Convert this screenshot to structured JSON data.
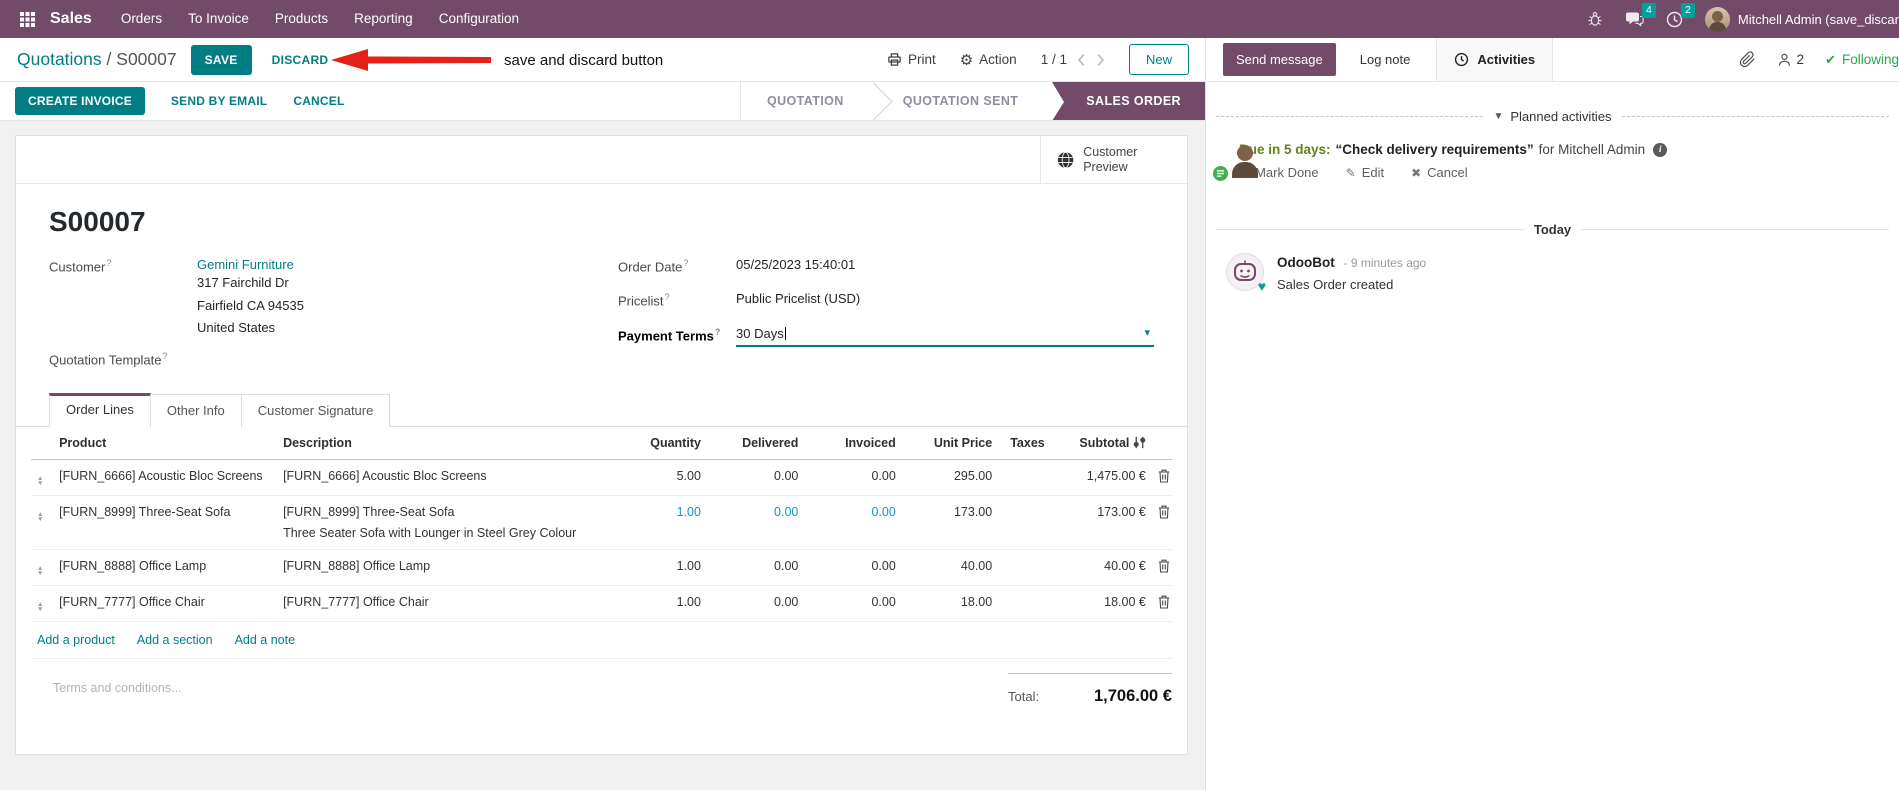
{
  "nav": {
    "app_name": "Sales",
    "menus": [
      "Orders",
      "To Invoice",
      "Products",
      "Reporting",
      "Configuration"
    ],
    "messages_badge": "4",
    "activities_badge": "2",
    "user_name": "Mitchell Admin (save_discar"
  },
  "control_bar": {
    "breadcrumb_parent": "Quotations",
    "breadcrumb_sep": "/",
    "breadcrumb_current": "S00007",
    "save_label": "SAVE",
    "discard_label": "DISCARD",
    "annotation_text": "save and discard button",
    "print_label": "Print",
    "action_label": "Action",
    "pager_value": "1 / 1",
    "new_label": "New"
  },
  "status_bar": {
    "create_invoice": "CREATE INVOICE",
    "send_by_email": "SEND BY EMAIL",
    "cancel": "CANCEL",
    "states": [
      "QUOTATION",
      "QUOTATION SENT",
      "SALES ORDER"
    ],
    "active_state": "SALES ORDER"
  },
  "sheet": {
    "customer_preview": "Customer Preview",
    "title": "S00007",
    "fields": {
      "customer_label": "Customer",
      "customer_name": "Gemini Furniture",
      "customer_address": [
        "317 Fairchild Dr",
        "Fairfield CA 94535",
        "United States"
      ],
      "quotation_template_label": "Quotation Template",
      "order_date_label": "Order Date",
      "order_date_value": "05/25/2023 15:40:01",
      "pricelist_label": "Pricelist",
      "pricelist_value": "Public Pricelist (USD)",
      "payment_terms_label": "Payment Terms",
      "payment_terms_value": "30 Days"
    },
    "tabs": [
      "Order Lines",
      "Other Info",
      "Customer Signature"
    ],
    "active_tab": "Order Lines",
    "order_lines": {
      "columns": {
        "product": "Product",
        "description": "Description",
        "quantity": "Quantity",
        "delivered": "Delivered",
        "invoiced": "Invoiced",
        "unit_price": "Unit Price",
        "taxes": "Taxes",
        "subtotal": "Subtotal"
      },
      "rows": [
        {
          "product": "[FURN_6666] Acoustic Bloc Screens",
          "description": "[FURN_6666] Acoustic Bloc Screens",
          "description2": "",
          "quantity": "5.00",
          "delivered": "0.00",
          "invoiced": "0.00",
          "unit_price": "295.00",
          "taxes": "",
          "subtotal": "1,475.00 €"
        },
        {
          "product": "[FURN_8999] Three-Seat Sofa",
          "description": "[FURN_8999] Three-Seat Sofa",
          "description2": "Three Seater Sofa with Lounger in Steel Grey Colour",
          "quantity": "1.00",
          "delivered": "0.00",
          "invoiced": "0.00",
          "unit_price": "173.00",
          "taxes": "",
          "subtotal": "173.00 €"
        },
        {
          "product": "[FURN_8888] Office Lamp",
          "description": "[FURN_8888] Office Lamp",
          "description2": "",
          "quantity": "1.00",
          "delivered": "0.00",
          "invoiced": "0.00",
          "unit_price": "40.00",
          "taxes": "",
          "subtotal": "40.00 €"
        },
        {
          "product": "[FURN_7777] Office Chair",
          "description": "[FURN_7777] Office Chair",
          "description2": "",
          "quantity": "1.00",
          "delivered": "0.00",
          "invoiced": "0.00",
          "unit_price": "18.00",
          "taxes": "",
          "subtotal": "18.00 €"
        }
      ],
      "footer_links": [
        "Add a product",
        "Add a section",
        "Add a note"
      ]
    },
    "terms_placeholder": "Terms and conditions...",
    "total_label": "Total:",
    "total_value": "1,706.00 €"
  },
  "chatter": {
    "send_message": "Send message",
    "log_note": "Log note",
    "activities": "Activities",
    "followers_count": "2",
    "following": "Following",
    "planned_title": "Planned activities",
    "activity": {
      "due": "Due in 5 days:",
      "summary": "“Check delivery requirements”",
      "for_user": "for Mitchell Admin",
      "mark_done": "Mark Done",
      "edit": "Edit",
      "cancel": "Cancel"
    },
    "today_label": "Today",
    "message": {
      "author": "OdooBot",
      "time": "- 9 minutes ago",
      "body": "Sales Order created"
    }
  },
  "colors": {
    "nav_bg": "#714B67",
    "primary_teal": "#017e84",
    "badge_teal": "#00A09D",
    "state_active_bg": "#714B67",
    "modified_blue": "#1095b5",
    "following_green": "#28a745",
    "due_green": "#66801e",
    "annotation_red": "#e32119"
  }
}
